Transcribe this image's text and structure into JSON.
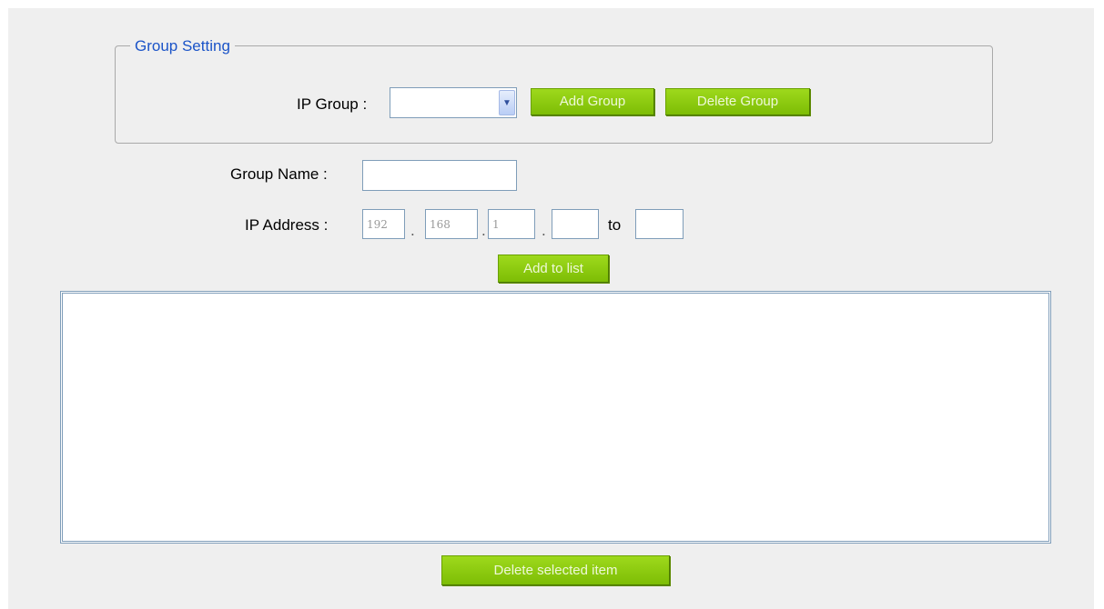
{
  "group_setting": {
    "legend": "Group Setting",
    "ip_group_label": "IP Group :",
    "ip_group_selected": "",
    "add_group_label": "Add Group",
    "delete_group_label": "Delete Group"
  },
  "group_name": {
    "label": "Group Name :",
    "value": ""
  },
  "ip_address": {
    "label": "IP Address :",
    "octet1": "192",
    "octet2": "168",
    "octet3": "1",
    "octet4": "",
    "to_label": "to",
    "range_end": ""
  },
  "add_to_list_label": "Add to list",
  "ip_list": {
    "items": []
  },
  "delete_selected_label": "Delete selected item",
  "icons": {
    "select_arrow": "chevron-down-icon"
  },
  "colors": {
    "legend": "#1b54c8",
    "button_green": "#8ccc0f",
    "panel_bg": "#efefef"
  }
}
